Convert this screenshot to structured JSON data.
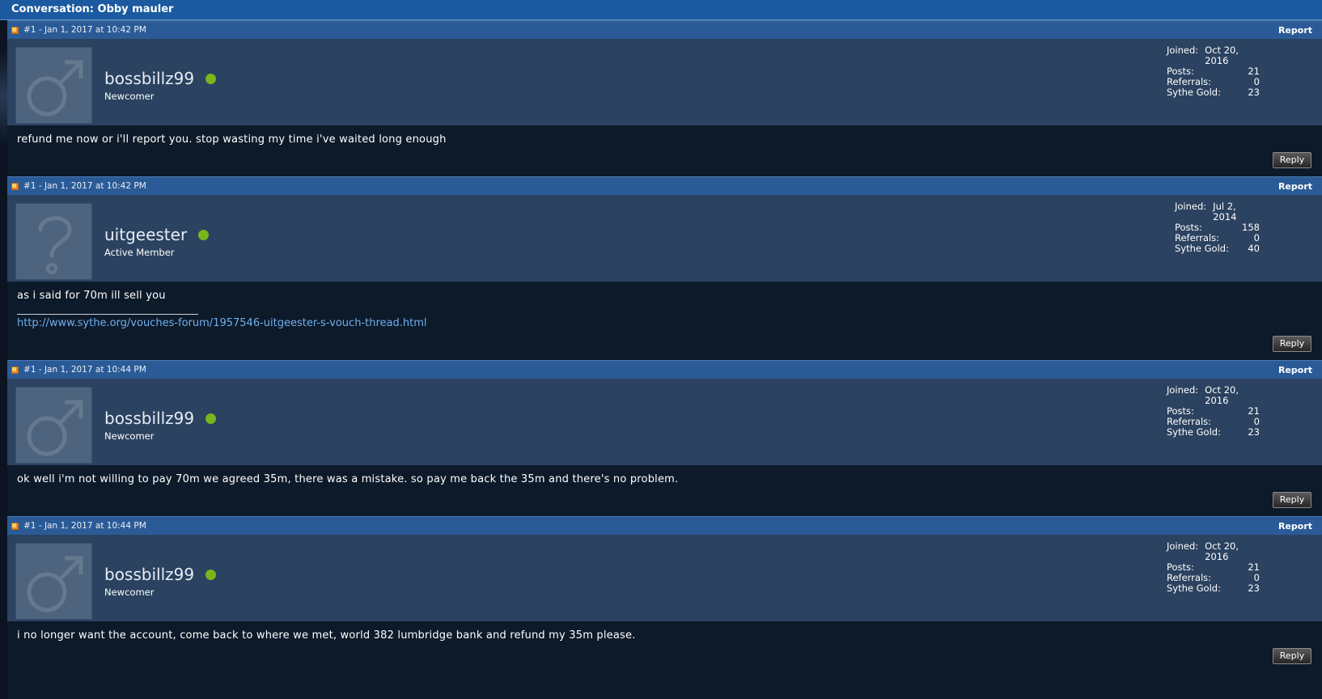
{
  "conversation": {
    "title": "Conversation: Obby mauler"
  },
  "posts": [
    {
      "meta": "#1 - Jan 1, 2017 at 10:42 PM",
      "report_label": "Report",
      "username": "bossbillz99",
      "rank": "Newcomer",
      "avatar_icon": "male-symbol-icon",
      "stats": {
        "joined_label": "Joined:",
        "joined": "Oct 20, 2016",
        "posts_label": "Posts:",
        "posts": "21",
        "referrals_label": "Referrals:",
        "referrals": "0",
        "gold_label": "Sythe Gold:",
        "gold": "23"
      },
      "message": "refund me now or i'll report you. stop wasting my time i've waited long enough",
      "reply_label": "Reply"
    },
    {
      "meta": "#1 - Jan 1, 2017 at 10:42 PM",
      "report_label": "Report",
      "username": "uitgeester",
      "rank": "Active Member",
      "avatar_icon": "question-mark-icon",
      "stats": {
        "joined_label": "Joined:",
        "joined": "Jul 2, 2014",
        "posts_label": "Posts:",
        "posts": "158",
        "referrals_label": "Referrals:",
        "referrals": "0",
        "gold_label": "Sythe Gold:",
        "gold": "40"
      },
      "message": "as i said for 70m ill sell you",
      "signature_link": "http://www.sythe.org/vouches-forum/1957546-uitgeester-s-vouch-thread.html",
      "reply_label": "Reply"
    },
    {
      "meta": "#1 - Jan 1, 2017 at 10:44 PM",
      "report_label": "Report",
      "username": "bossbillz99",
      "rank": "Newcomer",
      "avatar_icon": "male-symbol-icon",
      "stats": {
        "joined_label": "Joined:",
        "joined": "Oct 20, 2016",
        "posts_label": "Posts:",
        "posts": "21",
        "referrals_label": "Referrals:",
        "referrals": "0",
        "gold_label": "Sythe Gold:",
        "gold": "23"
      },
      "message": "ok well i'm not willing to pay 70m we agreed 35m, there was a mistake. so pay me back the 35m and there's no problem.",
      "reply_label": "Reply"
    },
    {
      "meta": "#1 - Jan 1, 2017 at 10:44 PM",
      "report_label": "Report",
      "username": "bossbillz99",
      "rank": "Newcomer",
      "avatar_icon": "male-symbol-icon",
      "stats": {
        "joined_label": "Joined:",
        "joined": "Oct 20, 2016",
        "posts_label": "Posts:",
        "posts": "21",
        "referrals_label": "Referrals:",
        "referrals": "0",
        "gold_label": "Sythe Gold:",
        "gold": "23"
      },
      "message": "i no longer want the account, come back to where we met, world 382 lumbridge bank and refund my 35m please.",
      "reply_label": "Reply"
    }
  ],
  "colors": {
    "header": "#1b5aa0",
    "post_bar": "#2b5b97",
    "user_panel": "#2b4260",
    "message_bg": "#0d1a2a",
    "online": "#7ab51d",
    "link": "#6fb0ee"
  }
}
